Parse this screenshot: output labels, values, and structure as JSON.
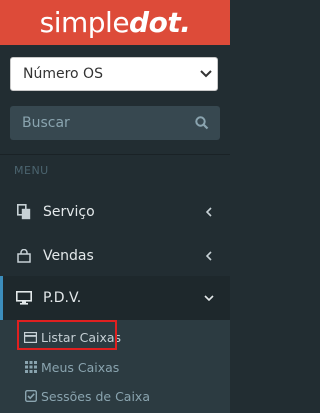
{
  "brand": {
    "light": "simple",
    "bold": "dot."
  },
  "selector": {
    "value": "Número OS"
  },
  "search": {
    "placeholder": "Buscar"
  },
  "menu": {
    "header": "MENU",
    "items": [
      {
        "label": "Serviço",
        "icon": "file-copy-icon"
      },
      {
        "label": "Vendas",
        "icon": "shopping-bag-icon"
      },
      {
        "label": "P.D.V.",
        "icon": "desktop-icon"
      }
    ],
    "submenu": [
      {
        "label": "Listar Caixas",
        "icon": "credit-card-icon"
      },
      {
        "label": "Meus Caixas",
        "icon": "grid-icon"
      },
      {
        "label": "Sessões de Caixa",
        "icon": "check-square-icon"
      }
    ]
  },
  "colors": {
    "header": "#dd4b39",
    "sidebar": "#222d32",
    "active_border": "#3c8dbc",
    "highlight": "#e02020"
  }
}
